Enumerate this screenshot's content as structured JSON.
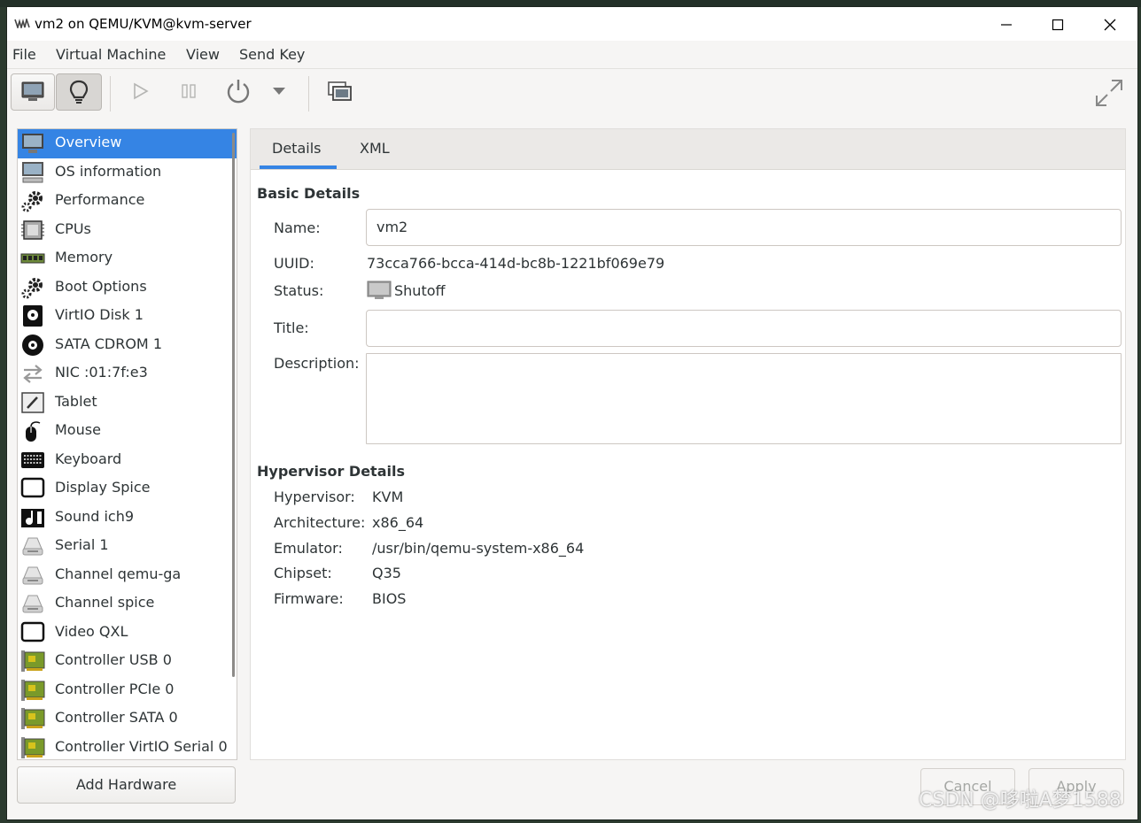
{
  "window": {
    "title": "vm2 on QEMU/KVM@kvm-server"
  },
  "menubar": [
    "File",
    "Virtual Machine",
    "View",
    "Send Key"
  ],
  "toolbar": {
    "buttons": [
      "console-monitor-icon",
      "details-lightbulb-icon",
      "run-icon",
      "pause-icon",
      "power-icon",
      "dropdown-arrow-icon",
      "snapshots-icon",
      "fullscreen-icon"
    ],
    "selected": "details-lightbulb-icon"
  },
  "sidebar": {
    "items": [
      {
        "label": "Overview",
        "icon": "monitor-icon",
        "selected": true
      },
      {
        "label": "OS information",
        "icon": "computer-icon"
      },
      {
        "label": "Performance",
        "icon": "gears-icon"
      },
      {
        "label": "CPUs",
        "icon": "cpu-icon"
      },
      {
        "label": "Memory",
        "icon": "memory-icon"
      },
      {
        "label": "Boot Options",
        "icon": "gears-icon"
      },
      {
        "label": "VirtIO Disk 1",
        "icon": "disk-icon"
      },
      {
        "label": "SATA CDROM 1",
        "icon": "cdrom-icon"
      },
      {
        "label": "NIC :01:7f:e3",
        "icon": "network-icon"
      },
      {
        "label": "Tablet",
        "icon": "tablet-icon"
      },
      {
        "label": "Mouse",
        "icon": "mouse-icon"
      },
      {
        "label": "Keyboard",
        "icon": "keyboard-icon"
      },
      {
        "label": "Display Spice",
        "icon": "display-icon"
      },
      {
        "label": "Sound ich9",
        "icon": "sound-icon"
      },
      {
        "label": "Serial 1",
        "icon": "serial-icon"
      },
      {
        "label": "Channel qemu-ga",
        "icon": "serial-icon"
      },
      {
        "label": "Channel spice",
        "icon": "serial-icon"
      },
      {
        "label": "Video QXL",
        "icon": "display-icon"
      },
      {
        "label": "Controller USB 0",
        "icon": "controller-card-icon"
      },
      {
        "label": "Controller PCIe 0",
        "icon": "controller-card-icon"
      },
      {
        "label": "Controller SATA 0",
        "icon": "controller-card-icon"
      },
      {
        "label": "Controller VirtIO Serial 0",
        "icon": "controller-card-icon"
      }
    ],
    "add_hardware": "Add Hardware"
  },
  "tabs": [
    "Details",
    "XML"
  ],
  "active_tab": "Details",
  "basic": {
    "heading": "Basic Details",
    "name_label": "Name:",
    "name_value": "vm2",
    "uuid_label": "UUID:",
    "uuid_value": "73cca766-bcca-414d-bc8b-1221bf069e79",
    "status_label": "Status:",
    "status_value": "Shutoff",
    "title_label": "Title:",
    "title_value": "",
    "description_label": "Description:",
    "description_value": ""
  },
  "hypervisor": {
    "heading": "Hypervisor Details",
    "rows": [
      {
        "label": "Hypervisor:",
        "value": "KVM"
      },
      {
        "label": "Architecture:",
        "value": "x86_64"
      },
      {
        "label": "Emulator:",
        "value": "/usr/bin/qemu-system-x86_64"
      },
      {
        "label": "Chipset:",
        "value": "Q35"
      },
      {
        "label": "Firmware:",
        "value": "BIOS"
      }
    ]
  },
  "actions": {
    "cancel": "Cancel",
    "apply": "Apply"
  },
  "watermark": "CSDN @哆啦A梦1588",
  "colors": {
    "accent": "#3584e4",
    "window_bg": "#f6f5f4",
    "text": "#2e3436",
    "disabled_text": "#a5a7a4"
  }
}
